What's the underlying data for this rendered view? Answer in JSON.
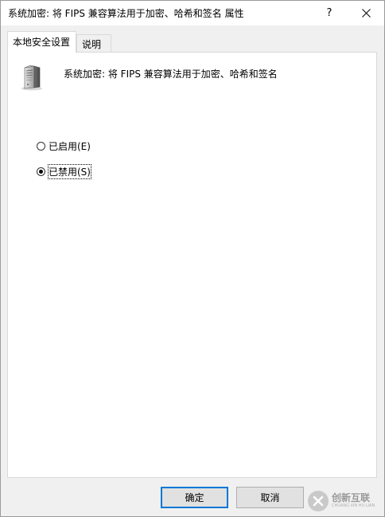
{
  "window": {
    "title": "系统加密: 将 FIPS 兼容算法用于加密、哈希和签名 属性",
    "help_label": "?"
  },
  "tabs": [
    {
      "label": "本地安全设置",
      "active": true
    },
    {
      "label": "说明",
      "active": false
    }
  ],
  "policy": {
    "icon": "server-icon",
    "label": "系统加密: 将 FIPS 兼容算法用于加密、哈希和签名"
  },
  "options": {
    "enabled": {
      "label": "已启用(E)",
      "checked": false
    },
    "disabled": {
      "label": "已禁用(S)",
      "checked": true
    }
  },
  "buttons": {
    "ok": "确定",
    "cancel": "取消"
  },
  "watermark": {
    "text": "创新互联",
    "subtext": "CHUANG XIN HU LIAN"
  },
  "colors": {
    "accent": "#0078d7",
    "panel_bg": "#ffffff",
    "window_bg": "#f0f0f0"
  }
}
